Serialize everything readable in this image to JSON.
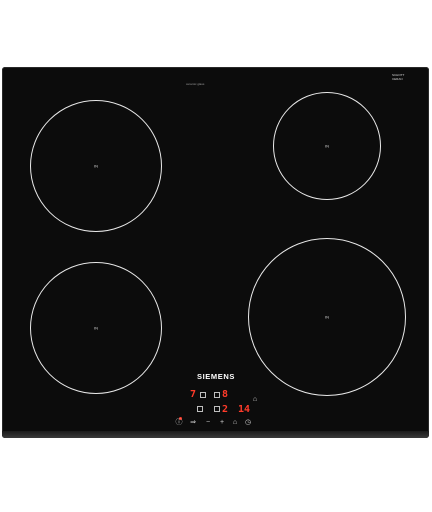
{
  "product": {
    "brand": "SIEMENS",
    "top_small_label": "ceramic glass",
    "certification_label": "SCHOTT CERAN"
  },
  "cooking_zones": [
    {
      "name": "front-left zone",
      "mark": "IN"
    },
    {
      "name": "rear-left zone",
      "mark": "IN"
    },
    {
      "name": "rear-right zone",
      "mark": "IN"
    },
    {
      "name": "front-right zone",
      "mark": "IN"
    }
  ],
  "control_panel": {
    "displays": [
      "7",
      "8",
      "2",
      "14"
    ],
    "icons": [
      "power-icon",
      "zone-select-icon",
      "minus-icon",
      "plus-icon",
      "child-lock-icon",
      "timer-icon",
      "bell-icon"
    ],
    "glyphs": {
      "power": "ⓘ",
      "zone_select": "⇒",
      "minus": "−",
      "plus": "+",
      "lock": "⌂",
      "timer": "◷",
      "bell": "⌂"
    }
  },
  "colors": {
    "glass": "#0c0c0c",
    "zone_outline": "#e9e9e9",
    "display_red": "#ff3b2a"
  }
}
